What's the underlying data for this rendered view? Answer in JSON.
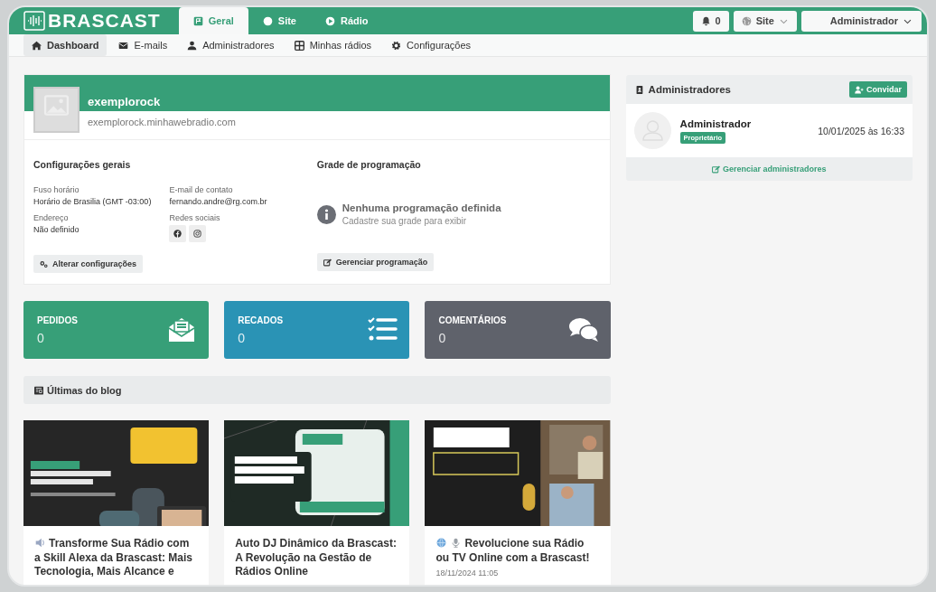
{
  "header": {
    "logo": "BRASCAST",
    "tabs": [
      {
        "label": "Geral",
        "selected": true
      },
      {
        "label": "Site",
        "selected": false
      },
      {
        "label": "Rádio",
        "selected": false
      }
    ],
    "notifications": "0",
    "site_menu": "Site",
    "user_menu": "Administrador"
  },
  "subnav": [
    {
      "label": "Dashboard",
      "selected": true
    },
    {
      "label": "E-mails",
      "selected": false
    },
    {
      "label": "Administradores",
      "selected": false
    },
    {
      "label": "Minhas rádios",
      "selected": false
    },
    {
      "label": "Configurações",
      "selected": false
    }
  ],
  "profile": {
    "name": "exemplorock",
    "domain": "exemplorock.minhawebradio.com",
    "settings": {
      "title": "Configurações gerais",
      "fields": [
        {
          "label": "Fuso horário",
          "value": "Horário de Brasilia (GMT -03:00)"
        },
        {
          "label": "Endereço",
          "value": "Não definido"
        }
      ],
      "contact_label": "E-mail de contato",
      "contact": "fernando.andre@rg.com.br",
      "social_label": "Redes sociais",
      "button": "Alterar configurações"
    },
    "schedule": {
      "title": "Grade de programação",
      "empty_title": "Nenhuma programação definida",
      "empty_text": "Cadastre sua grade para exibir",
      "button": "Gerenciar programação"
    }
  },
  "stats": [
    {
      "label": "PEDIDOS",
      "value": "0",
      "color": "#379f78"
    },
    {
      "label": "RECADOS",
      "value": "0",
      "color": "#2a93b5"
    },
    {
      "label": "COMENTÁRIOS",
      "value": "0",
      "color": "#5f626b"
    }
  ],
  "blog": {
    "title": "Últimas do blog",
    "posts": [
      {
        "title": "Transforme Sua Rádio com a Skill Alexa da Brascast: Mais Tecnologia, Mais Alcance e"
      },
      {
        "title": "Auto DJ Dinâmico da Brascast: A Revolução na Gestão de Rádios Online"
      },
      {
        "title": "Revolucione sua Rádio ou TV Online com a Brascast!",
        "date": "18/11/2024 11:05"
      }
    ]
  },
  "admins": {
    "title": "Administradores",
    "invite": "Convidar",
    "items": [
      {
        "name": "Administrador",
        "role": "Proprietário",
        "date": "10/01/2025 às 16:33"
      }
    ],
    "manage": "Gerenciar administradores"
  }
}
